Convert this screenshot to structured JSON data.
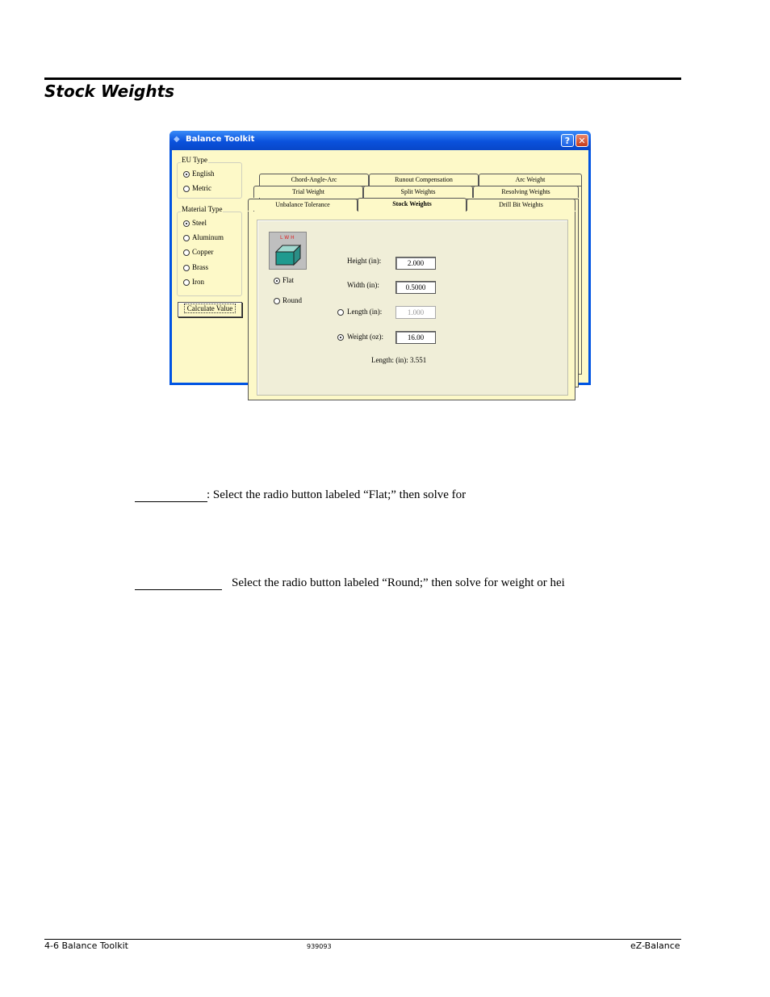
{
  "page": {
    "heading": "Stock Weights",
    "para_flat": ":  Select the radio button labeled “Flat;” then solve for",
    "para_round": "Select the radio button labeled “Round;” then solve for weight or hei"
  },
  "window": {
    "title": "Balance Toolkit",
    "help_glyph": "?",
    "close_glyph": "✕",
    "eu_type": {
      "legend": "EU Type",
      "options": [
        "English",
        "Metric"
      ],
      "selected": "English"
    },
    "material_type": {
      "legend": "Material Type",
      "options": [
        "Steel",
        "Aluminum",
        "Copper",
        "Brass",
        "Iron"
      ],
      "selected": "Steel"
    },
    "calculate_label": "Calculate Value",
    "tabs_row1": [
      "Chord-Angle-Arc",
      "Runout Compensation",
      "Arc Weight"
    ],
    "tabs_row2": [
      "Trial  Weight",
      "Split Weights",
      "Resolving Weights"
    ],
    "tabs_row3": [
      "Unbalance Tolerance",
      "Stock Weights",
      "Drill Bit Weights"
    ],
    "active_tab": "Stock Weights",
    "image_label": "L W H",
    "shape": {
      "options": [
        "Flat",
        "Round"
      ],
      "selected": "Flat"
    },
    "fields": {
      "height_label": "Height  (in):",
      "height_value": "2.000",
      "width_label": "Width  (in):",
      "width_value": "0.5000",
      "length_label": "Length  (in):",
      "length_value": "1.000",
      "weight_label": "Weight  (oz):",
      "weight_value": "16.00",
      "result": "Length:  (in):  3.551"
    }
  },
  "footer": {
    "left": "4-6    Balance Toolkit",
    "center": "939093",
    "right": "eZ-Balance"
  }
}
